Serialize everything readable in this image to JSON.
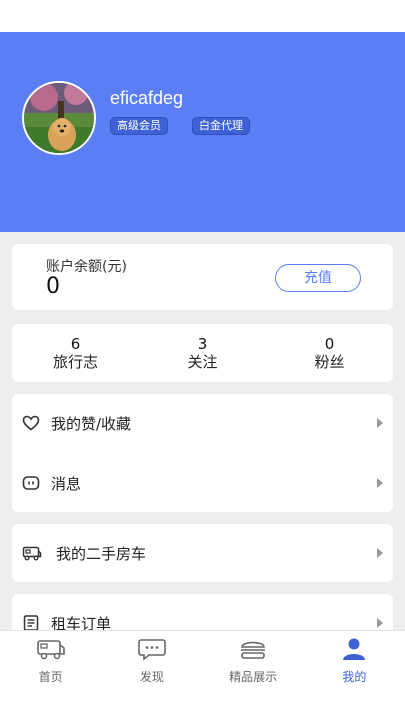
{
  "profile": {
    "username": "eficafdeg",
    "badges": {
      "vip": "高级会员",
      "agent": "白金代理"
    }
  },
  "balance": {
    "label": "账户余额(元)",
    "value": "0",
    "recharge_label": "充值"
  },
  "stats": {
    "travel_log": {
      "value": "6",
      "label": "旅行志"
    },
    "following": {
      "value": "3",
      "label": "关注"
    },
    "fans": {
      "value": "0",
      "label": "粉丝"
    }
  },
  "menu": {
    "likes": {
      "label": "我的赞/收藏",
      "icon": "heart-icon"
    },
    "messages": {
      "label": "消息",
      "icon": "message-icon"
    },
    "used_rv": {
      "label": "我的二手房车",
      "icon": "rv-icon"
    },
    "rental_orders": {
      "label": "租车订单",
      "icon": "order-icon"
    }
  },
  "tabs": {
    "home": {
      "label": "首页",
      "icon": "rv-icon"
    },
    "discover": {
      "label": "发现",
      "icon": "chat-icon"
    },
    "showcase": {
      "label": "精品展示",
      "icon": "burger-icon"
    },
    "mine": {
      "label": "我的",
      "icon": "user-icon",
      "active": true
    }
  },
  "colors": {
    "header": "#5b7ef5",
    "accent": "#3e62d6",
    "background": "#eeeeee"
  }
}
